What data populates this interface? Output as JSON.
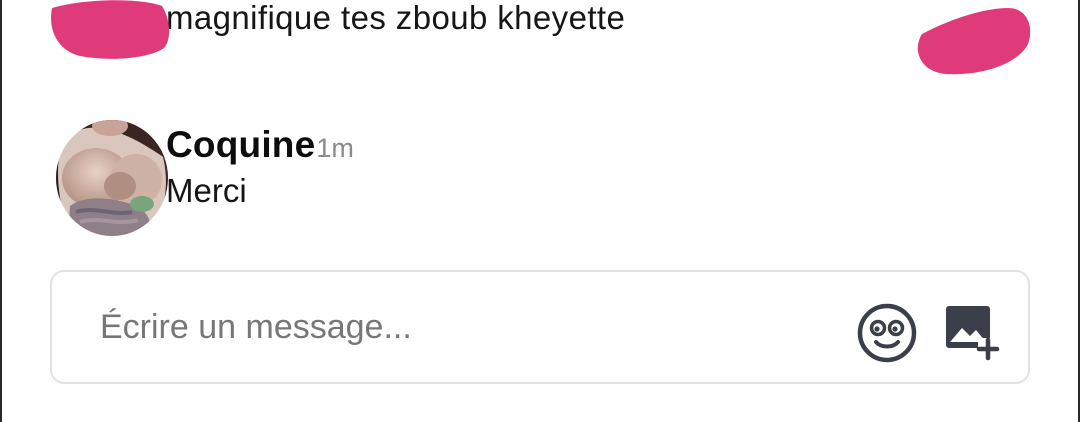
{
  "previous_message": {
    "text": "magnifique tes zboub kheyette"
  },
  "comment": {
    "author": "Coquine",
    "time": "1m",
    "text": "Merci"
  },
  "composer": {
    "placeholder": "Écrire un message..."
  },
  "icons": {
    "emoji": "smiley-icon",
    "image_upload": "add-image-icon"
  },
  "colors": {
    "redaction": "#df3a7a",
    "muted_text": "#8a8a8a",
    "icon": "#3a3f4a"
  }
}
